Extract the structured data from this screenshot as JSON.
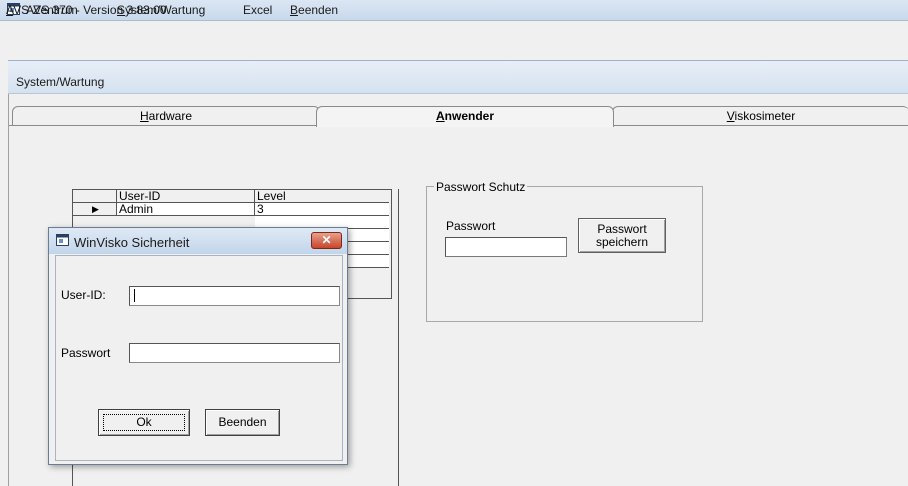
{
  "app": {
    "title": "AVS 370 - Version 3.83.00"
  },
  "menu": [
    {
      "label": "AVS-Zentrum",
      "hotkey": "A",
      "rest": "VS-Zentrum"
    },
    {
      "label": "System/Wartung",
      "hotkey": "S",
      "rest": "ystem/Wartung"
    },
    {
      "label": "Excel",
      "hotkey": "",
      "rest": "Excel"
    },
    {
      "label": "Beenden",
      "hotkey": "B",
      "rest": "eenden"
    }
  ],
  "child": {
    "title": "System/Wartung"
  },
  "tabs": [
    {
      "label": "Hardware",
      "hotkey": "H",
      "rest": "ardware",
      "active": false
    },
    {
      "label": "Anwender",
      "hotkey": "A",
      "rest": "nwender",
      "active": true
    },
    {
      "label": "Viskosimeter",
      "hotkey": "V",
      "rest": "iskosimeter",
      "active": false
    }
  ],
  "users_grid": {
    "columns": [
      "User-ID",
      "Level"
    ],
    "rows": [
      {
        "user_id": "Admin",
        "level": "3",
        "current": true
      }
    ],
    "row_pointer": "▶"
  },
  "password_group": {
    "title": "Passwort Schutz",
    "label": "Passwort",
    "value": "",
    "save_button": [
      "Passwort",
      "speichern"
    ]
  },
  "dialog": {
    "title": "WinVisko Sicherheit",
    "close_glyph": "✕",
    "user_label": "User-ID:",
    "user_value": "",
    "password_label": "Passwort",
    "password_value": "",
    "ok_label": "Ok",
    "cancel_label": "Beenden"
  }
}
